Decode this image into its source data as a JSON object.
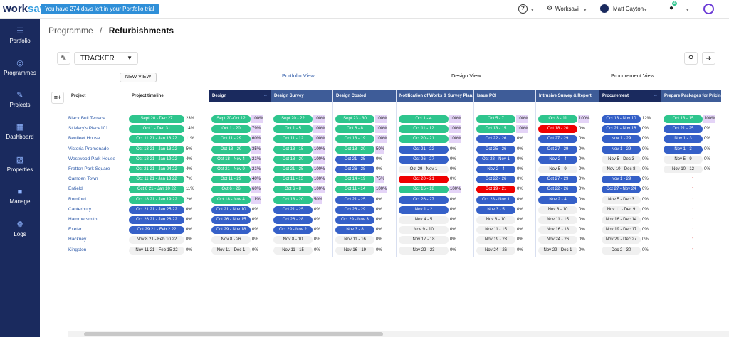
{
  "app": {
    "logo_text": "worksavi",
    "trial_banner": "You have 274 days left in your Portfolio trial"
  },
  "topbar": {
    "help_icon": "?",
    "org_name": "Worksavi",
    "user_name": "Matt Cayton",
    "notif_count": "4"
  },
  "sidebar": {
    "items": [
      {
        "label": "Portfolio",
        "icon": "grid-icon"
      },
      {
        "label": "Programmes",
        "icon": "target-icon"
      },
      {
        "label": "Projects",
        "icon": "pen-icon"
      },
      {
        "label": "Dashboard",
        "icon": "chart-icon"
      },
      {
        "label": "Properties",
        "icon": "building-icon"
      },
      {
        "label": "Manage",
        "icon": "person-icon"
      },
      {
        "label": "Logs",
        "icon": "gear-icon"
      }
    ]
  },
  "breadcrumb": {
    "parent": "Programme",
    "separator": "/",
    "current": "Refurbishments"
  },
  "toolbar": {
    "view_select": "TRACKER",
    "new_view": "NEW VIEW"
  },
  "views": [
    "Portfolio View",
    "Design View",
    "Procurement View"
  ],
  "columns": [
    "Project",
    "Project timeline",
    "Design",
    "Design Survey",
    "Design Costed",
    "Notification of Works & Survey Plans",
    "Issue PCI",
    "Intrusive Survey & Report",
    "Procurement",
    "Prepare Packages for Pricing"
  ],
  "rows": [
    {
      "project": "Black Bull Terrace",
      "cells": [
        [
          "g",
          "Sept 20  -  Dec 27",
          "23%"
        ],
        [
          "g",
          "Sept 20-Oct 12",
          "100%"
        ],
        [
          "g",
          "Sept 20  -  22",
          "100%"
        ],
        [
          "g",
          "Sept 23  -  30",
          "100%"
        ],
        [
          "g",
          "Oct 1  -  4",
          "100%"
        ],
        [
          "g",
          "Oct 5  -  7",
          "100%"
        ],
        [
          "g",
          "Oct 8  -  11",
          "100%"
        ],
        [
          "b",
          "Oct 13 - Nov 10",
          "12%"
        ],
        [
          "g",
          "Oct 13  -  15",
          "100%"
        ]
      ]
    },
    {
      "project": "St Mary's Place101",
      "cells": [
        [
          "g",
          "Oct 1  -  Dec 31",
          "14%"
        ],
        [
          "g",
          "Oct 1  -  20",
          "79%"
        ],
        [
          "g",
          "Oct 1  -  5",
          "100%"
        ],
        [
          "g",
          "Oct 6  -  8",
          "100%"
        ],
        [
          "g",
          "Oct 11  -  12",
          "100%"
        ],
        [
          "g",
          "Oct 13  -  15",
          "100%"
        ],
        [
          "r",
          "Oct 18  -  20",
          "0%"
        ],
        [
          "b",
          "Oct 21 - Nov 16",
          "0%"
        ],
        [
          "b",
          "Oct 21  -  25",
          "0%"
        ]
      ]
    },
    {
      "project": "Benfleet House",
      "cells": [
        [
          "g",
          "Oct 11 21 - Jan 13 22",
          "11%"
        ],
        [
          "g",
          "Oct 11  -  29",
          "60%"
        ],
        [
          "g",
          "Oct 11  -  12",
          "100%"
        ],
        [
          "g",
          "Oct 13  -  19",
          "100%"
        ],
        [
          "g",
          "Oct 20  -  21",
          "100%"
        ],
        [
          "b",
          "Oct 22  -  26",
          "0%"
        ],
        [
          "b",
          "Oct 27  -  29",
          "0%"
        ],
        [
          "b",
          "Nov 1  -  29",
          "0%"
        ],
        [
          "b",
          "Nov 1  -  3",
          "0%"
        ]
      ]
    },
    {
      "project": "Victoria Promenade",
      "cells": [
        [
          "g",
          "Oct 13 21 - Jan 13 22",
          "5%"
        ],
        [
          "g",
          "Oct 13  -  29",
          "35%"
        ],
        [
          "g",
          "Oct 13  -  15",
          "100%"
        ],
        [
          "g",
          "Oct 18  -  20",
          "50%"
        ],
        [
          "b",
          "Oct 21  -  22",
          "0%"
        ],
        [
          "b",
          "Oct 25  -  26",
          "0%"
        ],
        [
          "b",
          "Oct 27  -  29",
          "0%"
        ],
        [
          "b",
          "Nov 1  -  29",
          "0%"
        ],
        [
          "b",
          "Nov 1  -  3",
          "0%"
        ]
      ]
    },
    {
      "project": "Westwood Park House",
      "cells": [
        [
          "g",
          "Oct 18 21 - Jan 19 22",
          "4%"
        ],
        [
          "g",
          "Oct 18 - Nov 4",
          "21%"
        ],
        [
          "g",
          "Oct 18  -  20",
          "100%"
        ],
        [
          "b",
          "Oct 21  -  25",
          "0%"
        ],
        [
          "b",
          "Oct 26  -  27",
          "0%"
        ],
        [
          "b",
          "Oct 28 - Nov 1",
          "0%"
        ],
        [
          "b",
          "Nov 2  -  4",
          "0%"
        ],
        [
          "w",
          "Nov 5 - Dec 3",
          "0%"
        ],
        [
          "w",
          "Nov 5  -  9",
          "0%"
        ]
      ]
    },
    {
      "project": "Fratton Park Square",
      "cells": [
        [
          "g",
          "Oct 21 21 - Jan 24 22",
          "4%"
        ],
        [
          "g",
          "Oct 21 - Nov 9",
          "21%"
        ],
        [
          "g",
          "Oct 21  -  25",
          "100%"
        ],
        [
          "b",
          "Oct 26  -  28",
          "0%"
        ],
        [
          "w",
          "Oct 29  -  Nov 1",
          "0%"
        ],
        [
          "b",
          "Nov 2  -  4",
          "0%"
        ],
        [
          "w",
          "Nov 5  -  9",
          "0%"
        ],
        [
          "w",
          "Nov 10 - Dec 8",
          "0%"
        ],
        [
          "w",
          "Nov 10  -  12",
          "0%"
        ]
      ]
    },
    {
      "project": "Camden Town",
      "cells": [
        [
          "g",
          "Oct 11 21 - Jan 13 22",
          "7%"
        ],
        [
          "g",
          "Oct 11  -  29",
          "40%"
        ],
        [
          "g",
          "Oct 11  -  13",
          "100%"
        ],
        [
          "g",
          "Oct 14  -  19",
          "75%"
        ],
        [
          "r",
          "Oct 20  -  21",
          "0%"
        ],
        [
          "b",
          "Oct 22  -  26",
          "0%"
        ],
        [
          "b",
          "Oct 27  -  29",
          "0%"
        ],
        [
          "b",
          "Nov 1  -  29",
          "0%"
        ],
        [
          "d",
          "-",
          ""
        ]
      ]
    },
    {
      "project": "Enfield",
      "cells": [
        [
          "g",
          "Oct 6 21 - Jan 10 22",
          "11%"
        ],
        [
          "g",
          "Oct 6  -  26",
          "60%"
        ],
        [
          "g",
          "Oct 6  -  8",
          "100%"
        ],
        [
          "g",
          "Oct 11  -  14",
          "100%"
        ],
        [
          "g",
          "Oct 15  -  18",
          "100%"
        ],
        [
          "r",
          "Oct 19  -  21",
          "0%"
        ],
        [
          "b",
          "Oct 22  -  26",
          "0%"
        ],
        [
          "b",
          "Oct 27 - Nov 24",
          "0%"
        ],
        [
          "d",
          "-",
          ""
        ]
      ]
    },
    {
      "project": "Romford",
      "cells": [
        [
          "g",
          "Oct 18 21 - Jan 19 22",
          "2%"
        ],
        [
          "g",
          "Oct 18 - Nov 4",
          "11%"
        ],
        [
          "g",
          "Oct 18  -  20",
          "50%"
        ],
        [
          "b",
          "Oct 21  -  25",
          "0%"
        ],
        [
          "b",
          "Oct 26  -  27",
          "0%"
        ],
        [
          "b",
          "Oct 28 - Nov 1",
          "0%"
        ],
        [
          "b",
          "Nov 2  -  4",
          "0%"
        ],
        [
          "w",
          "Nov 5 - Dec 3",
          "0%"
        ],
        [
          "d",
          "-",
          ""
        ]
      ]
    },
    {
      "project": "Canterbury",
      "cells": [
        [
          "b",
          "Oct 21 21 - Jan 25 22",
          "0%"
        ],
        [
          "b",
          "Oct 21 - Nov 10",
          "0%"
        ],
        [
          "b",
          "Oct 21  -  25",
          "0%"
        ],
        [
          "b",
          "Oct 26  -  29",
          "0%"
        ],
        [
          "b",
          "Nov 1  -  2",
          "0%"
        ],
        [
          "b",
          "Nov 3  -  5",
          "0%"
        ],
        [
          "w",
          "Nov 8  -  10",
          "0%"
        ],
        [
          "w",
          "Nov 11 - Dec 9",
          "0%"
        ],
        [
          "d",
          "-",
          ""
        ]
      ]
    },
    {
      "project": "Hammersmith",
      "cells": [
        [
          "b",
          "Oct 26 21 - Jan 28 22",
          "0%"
        ],
        [
          "b",
          "Oct 26 - Nov 15",
          "0%"
        ],
        [
          "b",
          "Oct 26  -  28",
          "0%"
        ],
        [
          "b",
          "Oct 29 - Nov 3",
          "0%"
        ],
        [
          "w",
          "Nov 4  -  5",
          "0%"
        ],
        [
          "w",
          "Nov 8  -  10",
          "0%"
        ],
        [
          "w",
          "Nov 11  -  15",
          "0%"
        ],
        [
          "w",
          "Nov 16 - Dec 14",
          "0%"
        ],
        [
          "d",
          "-",
          ""
        ]
      ]
    },
    {
      "project": "Exeter",
      "cells": [
        [
          "b",
          "Oct 29 21 - Feb 2 22",
          "0%"
        ],
        [
          "b",
          "Oct 29 - Nov 18",
          "0%"
        ],
        [
          "b",
          "Oct 29 - Nov 2",
          "0%"
        ],
        [
          "b",
          "Nov 3  -  8",
          "0%"
        ],
        [
          "w",
          "Nov 9  -  10",
          "0%"
        ],
        [
          "w",
          "Nov 11  -  15",
          "0%"
        ],
        [
          "w",
          "Nov 16  -  18",
          "0%"
        ],
        [
          "w",
          "Nov 19 - Dec 17",
          "0%"
        ],
        [
          "d",
          "-",
          ""
        ]
      ]
    },
    {
      "project": "Hackney",
      "cells": [
        [
          "w",
          "Nov 8 21 - Feb 10 22",
          "0%"
        ],
        [
          "w",
          "Nov 8  -  26",
          "0%"
        ],
        [
          "w",
          "Nov 8  -  10",
          "0%"
        ],
        [
          "w",
          "Nov 11  -  16",
          "0%"
        ],
        [
          "w",
          "Nov 17  -  18",
          "0%"
        ],
        [
          "w",
          "Nov 19  -  23",
          "0%"
        ],
        [
          "w",
          "Nov 24  -  26",
          "0%"
        ],
        [
          "w",
          "Nov 29 - Dec 27",
          "0%"
        ],
        [
          "d",
          "-",
          ""
        ]
      ]
    },
    {
      "project": "Kingston",
      "cells": [
        [
          "w",
          "Nov 11 21 - Feb 15 22",
          "0%"
        ],
        [
          "w",
          "Nov 11 - Dec 1",
          "0%"
        ],
        [
          "w",
          "Nov 11  -  15",
          "0%"
        ],
        [
          "w",
          "Nov 16  -  19",
          "0%"
        ],
        [
          "w",
          "Nov 22  -  23",
          "0%"
        ],
        [
          "w",
          "Nov 24  -  26",
          "0%"
        ],
        [
          "w",
          "Nov 29  -  Dec 1",
          "0%"
        ],
        [
          "w",
          "Dec 2  -  30",
          "0%"
        ],
        [
          "d",
          "-",
          ""
        ]
      ]
    }
  ],
  "colors": {
    "sidebar": "#1a2a5e",
    "complete": "#2ec58d",
    "in_progress": "#3560c8",
    "overdue": "#ef0000",
    "not_started": "#f0f0f0",
    "highlight": "#e4d4f7"
  }
}
